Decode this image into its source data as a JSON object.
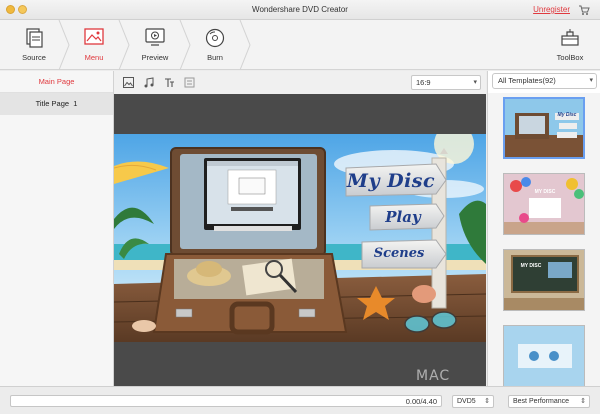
{
  "window": {
    "title": "Wondershare DVD Creator",
    "unregister_label": "Unregister"
  },
  "toolbar": {
    "steps": [
      {
        "label": "Source",
        "icon": "source-icon",
        "active": false
      },
      {
        "label": "Menu",
        "icon": "menu-icon",
        "active": true
      },
      {
        "label": "Preview",
        "icon": "preview-icon",
        "active": false
      },
      {
        "label": "Burn",
        "icon": "burn-icon",
        "active": false
      }
    ],
    "toolbox_label": "ToolBox"
  },
  "left_panel": {
    "main_page": "Main Page",
    "title_page": "Title Page",
    "title_page_num": "1"
  },
  "editor": {
    "aspect_ratio": "16:9"
  },
  "menu_preview": {
    "title": "My Disc",
    "play": "Play",
    "scenes": "Scenes"
  },
  "templates": {
    "filter": "All Templates(92)",
    "thumb_titles": [
      "My Disc",
      "MY DISC",
      "MY DISC",
      ""
    ]
  },
  "bottom": {
    "progress_text": "0.00/4.40",
    "progress_fraction": 0,
    "disc_type": "DVD5",
    "quality": "Best Performance"
  },
  "colors": {
    "accent": "#e0393e",
    "selection": "#6a9ff0"
  },
  "watermark": "MAC"
}
